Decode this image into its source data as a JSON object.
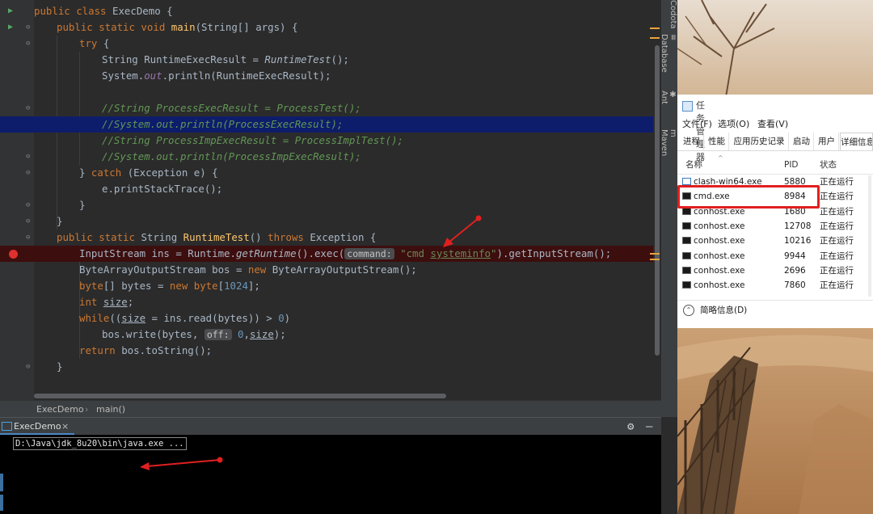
{
  "editor": {
    "lines": [
      {
        "segments": [
          {
            "t": "public class ",
            "c": "kw"
          },
          {
            "t": "ExecDemo {",
            "c": ""
          }
        ],
        "indent": 0
      },
      {
        "segments": [
          {
            "t": "public static void ",
            "c": "kw"
          },
          {
            "t": "main",
            "c": "fn"
          },
          {
            "t": "(String[] args) {",
            "c": ""
          }
        ],
        "indent": 1
      },
      {
        "segments": [
          {
            "t": "try ",
            "c": "kw"
          },
          {
            "t": "{",
            "c": ""
          }
        ],
        "indent": 2
      },
      {
        "segments": [
          {
            "t": "String RuntimeExecResult = ",
            "c": ""
          },
          {
            "t": "RuntimeTest",
            "c": "it"
          },
          {
            "t": "();",
            "c": ""
          }
        ],
        "indent": 3
      },
      {
        "segments": [
          {
            "t": "System.",
            "c": ""
          },
          {
            "t": "out",
            "c": "fld"
          },
          {
            "t": ".println(RuntimeExecResult);",
            "c": ""
          }
        ],
        "indent": 3
      },
      {
        "segments": [],
        "indent": 0
      },
      {
        "segments": [
          {
            "t": "//String ProcessExecResult = ProcessTest();",
            "c": "cm"
          }
        ],
        "indent": 3
      },
      {
        "segments": [
          {
            "t": "//System.out.println(ProcessExecResult);",
            "c": "cm"
          }
        ],
        "indent": 3,
        "highlight": "blue"
      },
      {
        "segments": [
          {
            "t": "//String ProcessImpExecResult = ProcessImplTest();",
            "c": "cm"
          }
        ],
        "indent": 3
      },
      {
        "segments": [
          {
            "t": "//System.out.println(ProcessImpExecResult);",
            "c": "cm"
          }
        ],
        "indent": 3
      },
      {
        "segments": [
          {
            "t": "} ",
            "c": ""
          },
          {
            "t": "catch ",
            "c": "kw"
          },
          {
            "t": "(Exception e) {",
            "c": ""
          }
        ],
        "indent": 2
      },
      {
        "segments": [
          {
            "t": "e.printStackTrace();",
            "c": ""
          }
        ],
        "indent": 3
      },
      {
        "segments": [
          {
            "t": "}",
            "c": ""
          }
        ],
        "indent": 2
      },
      {
        "segments": [
          {
            "t": "}",
            "c": ""
          }
        ],
        "indent": 1
      },
      {
        "segments": [
          {
            "t": "public static ",
            "c": "kw"
          },
          {
            "t": "String ",
            "c": ""
          },
          {
            "t": "RuntimeTest",
            "c": "fn"
          },
          {
            "t": "() ",
            "c": ""
          },
          {
            "t": "throws ",
            "c": "kw"
          },
          {
            "t": "Exception {",
            "c": ""
          }
        ],
        "indent": 1
      },
      {
        "segments": [
          {
            "t": "InputStream ins = Runtime.",
            "c": ""
          },
          {
            "t": "getRuntime",
            "c": "it"
          },
          {
            "t": "().exec(",
            "c": ""
          },
          {
            "t": "command:",
            "c": "hint"
          },
          {
            "t": " \"cmd ",
            "c": "st"
          },
          {
            "t": "systeminfo",
            "c": "st ul"
          },
          {
            "t": "\"",
            "c": "st"
          },
          {
            "t": ").getInputStream();",
            "c": ""
          }
        ],
        "indent": 2,
        "highlight": "red",
        "breakpoint": true
      },
      {
        "segments": [
          {
            "t": "ByteArrayOutputStream bos = ",
            "c": ""
          },
          {
            "t": "new ",
            "c": "kw"
          },
          {
            "t": "ByteArrayOutputStream();",
            "c": ""
          }
        ],
        "indent": 2
      },
      {
        "segments": [
          {
            "t": "byte",
            "c": "kw"
          },
          {
            "t": "[] bytes = ",
            "c": ""
          },
          {
            "t": "new byte",
            "c": "kw"
          },
          {
            "t": "[",
            "c": ""
          },
          {
            "t": "1024",
            "c": "nm"
          },
          {
            "t": "];",
            "c": ""
          }
        ],
        "indent": 2
      },
      {
        "segments": [
          {
            "t": "int ",
            "c": "kw"
          },
          {
            "t": "size",
            "c": "ul"
          },
          {
            "t": ";",
            "c": ""
          }
        ],
        "indent": 2
      },
      {
        "segments": [
          {
            "t": "while",
            "c": "kw"
          },
          {
            "t": "((",
            "c": ""
          },
          {
            "t": "size",
            "c": "ul"
          },
          {
            "t": " = ins.read(bytes)) > ",
            "c": ""
          },
          {
            "t": "0",
            "c": "nm"
          },
          {
            "t": ")",
            "c": ""
          }
        ],
        "indent": 2
      },
      {
        "segments": [
          {
            "t": "bos.write(bytes, ",
            "c": ""
          },
          {
            "t": "off:",
            "c": "hint"
          },
          {
            "t": " ",
            "c": ""
          },
          {
            "t": "0",
            "c": "nm"
          },
          {
            "t": ",",
            "c": ""
          },
          {
            "t": "size",
            "c": "ul"
          },
          {
            "t": ");",
            "c": ""
          }
        ],
        "indent": 3
      },
      {
        "segments": [
          {
            "t": "return ",
            "c": "kw"
          },
          {
            "t": "bos.toString();",
            "c": ""
          }
        ],
        "indent": 2
      },
      {
        "segments": [
          {
            "t": "}",
            "c": ""
          }
        ],
        "indent": 1
      }
    ]
  },
  "breadcrumb": {
    "class_name": "ExecDemo",
    "separator": "›",
    "method": "main()"
  },
  "side_tabs": [
    {
      "label": "Codota",
      "icon": ""
    },
    {
      "label": "Database",
      "icon": "database-icon"
    },
    {
      "label": "Ant",
      "icon": "ant-icon"
    },
    {
      "label": "Maven",
      "icon": "maven-icon"
    }
  ],
  "run_panel": {
    "tab_label": "ExecDemo",
    "close_glyph": "×",
    "console_line": "D:\\Java\\jdk_8u20\\bin\\java.exe ..."
  },
  "task_manager": {
    "title": "任务管理器",
    "menu": [
      "文件(F)",
      "选项(O)",
      "查看(V)"
    ],
    "tabs": [
      "进程",
      "性能",
      "应用历史记录",
      "启动",
      "用户",
      "详细信息"
    ],
    "active_tab": "详细信息",
    "columns": [
      "名称",
      "PID",
      "状态"
    ],
    "rows": [
      {
        "name": "clash-win64.exe",
        "pid": "5880",
        "status": "正在运行",
        "icon": "blue"
      },
      {
        "name": "cmd.exe",
        "pid": "8984",
        "status": "正在运行",
        "icon": "console",
        "highlighted": true
      },
      {
        "name": "conhost.exe",
        "pid": "1680",
        "status": "正在运行",
        "icon": "console"
      },
      {
        "name": "conhost.exe",
        "pid": "12708",
        "status": "正在运行",
        "icon": "console"
      },
      {
        "name": "conhost.exe",
        "pid": "10216",
        "status": "正在运行",
        "icon": "console"
      },
      {
        "name": "conhost.exe",
        "pid": "9944",
        "status": "正在运行",
        "icon": "console"
      },
      {
        "name": "conhost.exe",
        "pid": "2696",
        "status": "正在运行",
        "icon": "console"
      },
      {
        "name": "conhost.exe",
        "pid": "7860",
        "status": "正在运行",
        "icon": "console"
      }
    ],
    "footer": "简略信息(D)"
  },
  "colors": {
    "annotation_red": "#e0201f",
    "breakpoint": "#e0302d",
    "selection_blue": "#0d1d6b"
  }
}
